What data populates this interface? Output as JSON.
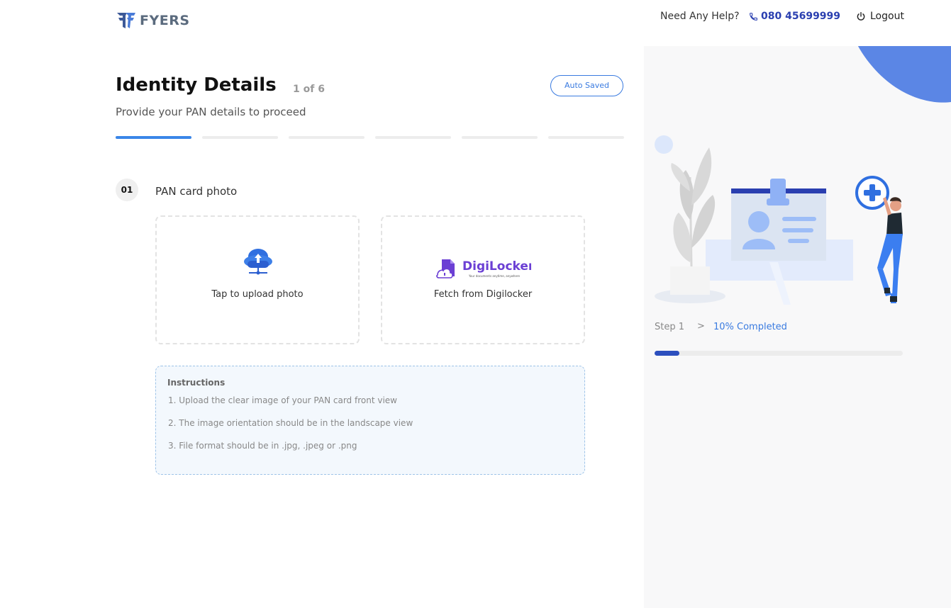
{
  "header": {
    "logo_text": "FYERS",
    "help_text": "Need Any Help?",
    "phone": "080 45699999",
    "logout_label": "Logout"
  },
  "main": {
    "title": "Identity Details",
    "step_count": "1 of 6",
    "autosaved_label": "Auto Saved",
    "subtitle": "Provide your PAN details to proceed",
    "progress_steps": 6,
    "progress_active": 1,
    "section_number": "01",
    "section_label": "PAN card photo",
    "upload_label": "Tap to upload photo",
    "digilocker_label": "Fetch from Digilocker",
    "digilocker_brand": "DigiLocker",
    "digilocker_tagline": "Your documents anytime, anywhere",
    "instructions": {
      "title": "Instructions",
      "items": [
        "1. Upload the clear image of your PAN card front view",
        "2. The image orientation should be in the landscape view",
        "3. File format should be in .jpg, .jpeg or .png"
      ]
    }
  },
  "side": {
    "step_label": "Step 1",
    "chevron": ">",
    "completed_label": "10% Completed",
    "completed_fraction": 0.1
  },
  "colors": {
    "accent": "#3a86e8",
    "brand_blue": "#2c4fbe",
    "digilocker_purple": "#6b3fd4"
  }
}
